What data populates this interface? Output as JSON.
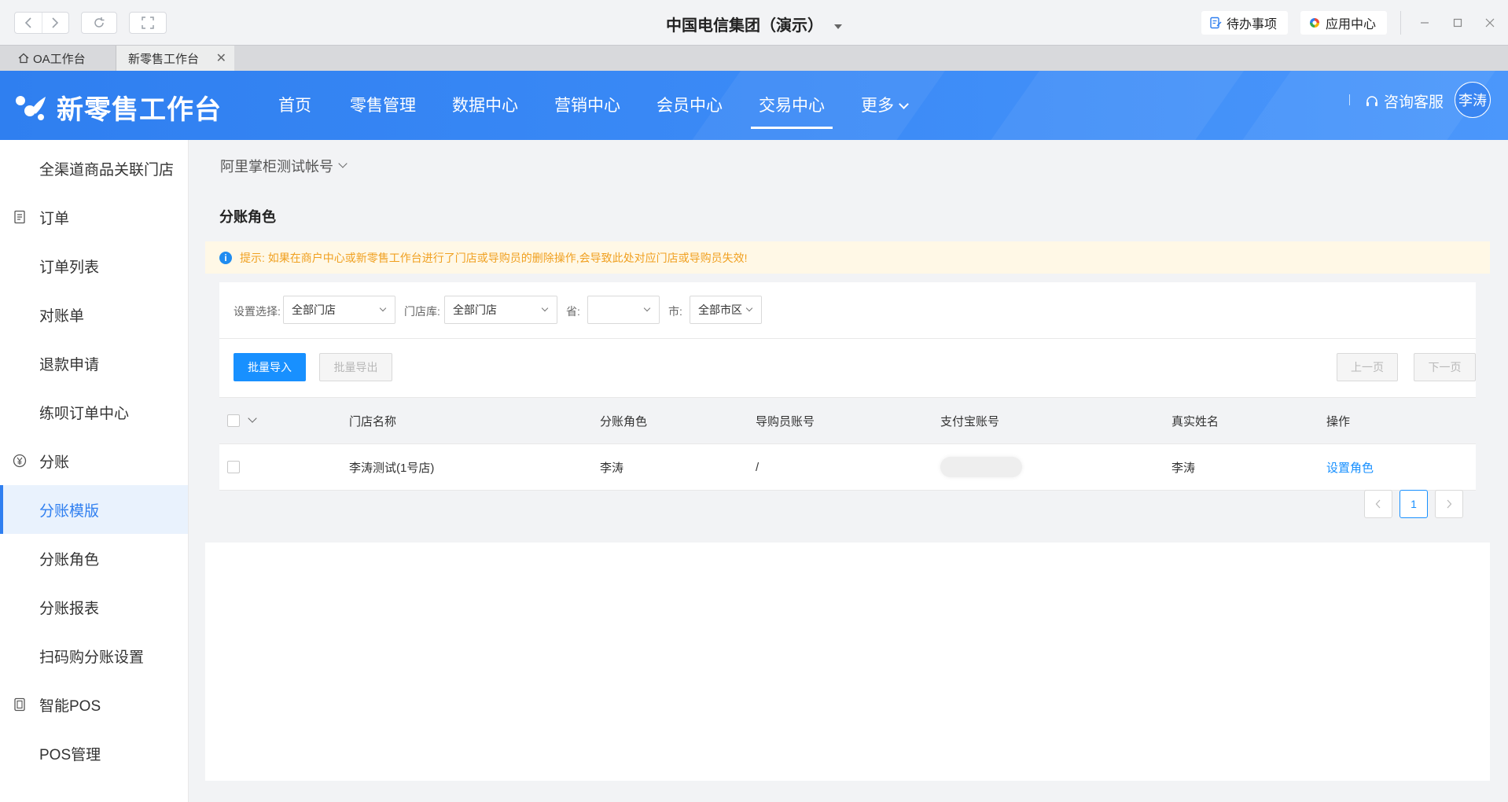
{
  "window": {
    "title": "中国电信集团（演示）",
    "todo_label": "待办事项",
    "app_center_label": "应用中心"
  },
  "tabs": [
    {
      "label": "OA工作台"
    },
    {
      "label": "新零售工作台"
    }
  ],
  "header": {
    "logo_text": "新零售工作台",
    "nav": [
      {
        "label": "首页"
      },
      {
        "label": "零售管理"
      },
      {
        "label": "数据中心"
      },
      {
        "label": "营销中心"
      },
      {
        "label": "会员中心"
      },
      {
        "label": "交易中心"
      },
      {
        "label": "更多"
      }
    ],
    "active_nav": "交易中心",
    "consult_label": "咨询客服",
    "user_name": "李涛"
  },
  "sidebar": {
    "items": [
      {
        "label": "全渠道商品关联门店",
        "type": "sub"
      },
      {
        "label": "订单",
        "type": "group",
        "icon": "order-doc-icon"
      },
      {
        "label": "订单列表",
        "type": "sub"
      },
      {
        "label": "对账单",
        "type": "sub"
      },
      {
        "label": "退款申请",
        "type": "sub"
      },
      {
        "label": "练呗订单中心",
        "type": "sub"
      },
      {
        "label": "分账",
        "type": "group",
        "icon": "yen-circle-icon"
      },
      {
        "label": "分账模版",
        "type": "sub",
        "active": true
      },
      {
        "label": "分账角色",
        "type": "sub"
      },
      {
        "label": "分账报表",
        "type": "sub"
      },
      {
        "label": "扫码购分账设置",
        "type": "sub"
      },
      {
        "label": "智能POS",
        "type": "group",
        "icon": "pos-terminal-icon"
      },
      {
        "label": "POS管理",
        "type": "sub"
      }
    ]
  },
  "main": {
    "account_selector": "阿里掌柜测试帐号",
    "card_title": "分账角色",
    "notice": "提示: 如果在商户中心或新零售工作台进行了门店或导购员的删除操作,会导致此处对应门店或导购员失效!",
    "filters": {
      "setting_label": "设置选择:",
      "setting_value": "全部门店",
      "store_label": "门店库:",
      "store_value": "全部门店",
      "province_label": "省:",
      "province_value": "",
      "city_label": "市:",
      "city_value": "全部市区"
    },
    "buttons": {
      "batch_import": "批量导入",
      "batch_export": "批量导出",
      "prev_page": "上一页",
      "next_page": "下一页"
    },
    "table": {
      "columns": [
        "门店名称",
        "分账角色",
        "导购员账号",
        "支付宝账号",
        "真实姓名",
        "操作"
      ],
      "rows": [
        {
          "store": "李涛测试(1号店)",
          "role": "李涛",
          "guide_account": "/",
          "alipay_account": "",
          "real_name": "李涛",
          "action": "设置角色"
        }
      ]
    },
    "pagination": {
      "current_page": "1"
    }
  },
  "colors": {
    "brand_blue": "#2f7ff0",
    "primary_button": "#1890ff",
    "notice_text": "#f0a020"
  }
}
